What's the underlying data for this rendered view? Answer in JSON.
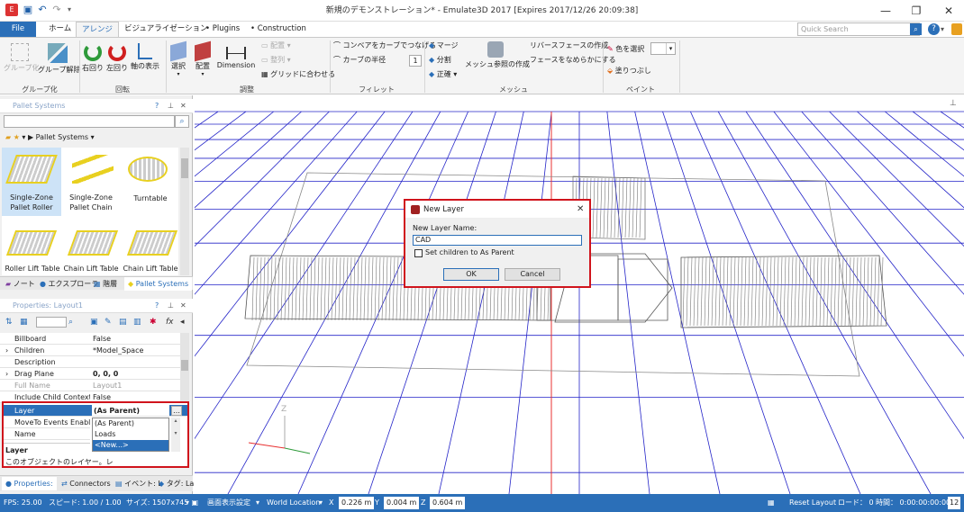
{
  "window": {
    "title": "新規のデモンストレーション* - Emulate3D 2017 [Expires 2017/12/26 20:09:38]"
  },
  "tabs": [
    "File",
    "ホーム",
    "アレンジ",
    "ビジュアライゼーション",
    "Plugins",
    "Construction"
  ],
  "quick_search": {
    "placeholder": "Quick Search"
  },
  "ribbon": {
    "group_grouping": {
      "label": "グループ化",
      "group": "グループ化",
      "ungroup": "グループ解除"
    },
    "group_rotate": {
      "label": "回転",
      "cw": "右回り",
      "ccw": "左回り",
      "axis": "軸の表示"
    },
    "group_adjust": {
      "label": "調整",
      "select": "選択",
      "place": "配置",
      "dimension": "Dimension",
      "arrange": "配置",
      "align": "整列",
      "grid": "グリッドに合わせる"
    },
    "group_fillet": {
      "label": "フィレット",
      "conveyor_curve": "コンベアをカーブでつなげる",
      "curve_radius": "カーブの半径",
      "radius_value": "1"
    },
    "group_mesh": {
      "label": "メッシュ",
      "merge": "マージ",
      "split": "分割",
      "normal": "正確",
      "mesh_ref": "メッシュ参照の作成",
      "reverse_face": "リバースフェースの作成",
      "smooth_face": "フェースをなめらかにする"
    },
    "group_paint": {
      "label": "ペイント",
      "pick_color": "色を選択",
      "fill": "塗りつぶし"
    }
  },
  "catalog": {
    "title": "Pallet Systems",
    "breadcrumb": "Pallet Systems",
    "items": [
      {
        "label": "Single-Zone Pallet Roller"
      },
      {
        "label": "Single-Zone Pallet Chain"
      },
      {
        "label": "Turntable"
      },
      {
        "label": "Roller Lift Table"
      },
      {
        "label": "Chain Lift Table"
      },
      {
        "label": "Chain Lift Table"
      }
    ],
    "tabs": [
      "ノート",
      "エクスプローラ",
      "階層",
      "Pallet Systems"
    ]
  },
  "properties": {
    "title": "Properties: Layout1",
    "rows": [
      {
        "name": "Billboard",
        "value": "False"
      },
      {
        "name": "Children",
        "value": "*Model_Space"
      },
      {
        "name": "Description",
        "value": ""
      },
      {
        "name": "Drag Plane",
        "value": "0, 0, 0"
      },
      {
        "name": "Full Name",
        "value": "Layout1"
      },
      {
        "name": "Include Child Context",
        "value": "False"
      },
      {
        "name": "Layer",
        "value": "(As Parent)"
      },
      {
        "name": "MoveTo Events Enable",
        "value": ""
      },
      {
        "name": "Name",
        "value": ""
      }
    ],
    "dropdown_options": [
      "(As Parent)",
      "Loads",
      "<New...>"
    ],
    "desc_title": "Layer",
    "desc_text": "このオブジェクトのレイヤー。レ",
    "bottom_tabs": [
      "Properties:",
      "Connectors",
      "イベント: L",
      "タグ: La"
    ]
  },
  "dialog": {
    "title": "New Layer",
    "field_label": "New Layer Name:",
    "field_value": "CAD",
    "checkbox_label": "Set children to As Parent",
    "ok": "OK",
    "cancel": "Cancel"
  },
  "statusbar": {
    "fps": "FPS: 25.00",
    "speed": "スピード: 1.00 / 1.00",
    "size": "サイズ: 1507x745",
    "display": "画面表示設定",
    "world": "World Location",
    "x_label": "X",
    "x_value": "0.226 m",
    "y_label": "Y",
    "y_value": "0.004 m",
    "z_label": "Z",
    "z_value": "0.604 m",
    "reset": "Reset Layout",
    "load": "ロード： 0",
    "time": "時間： 0:00:00:00:00",
    "num": "12"
  },
  "colors": {
    "accent": "#2b6fb8",
    "highlight_border": "#d0141c",
    "grid": "#2424c8",
    "axis_red": "#e83030"
  }
}
